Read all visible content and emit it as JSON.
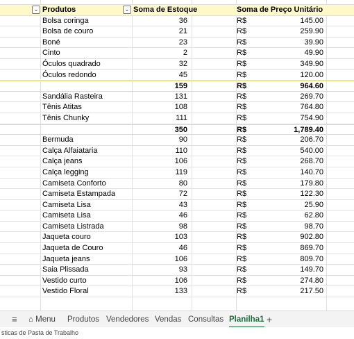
{
  "header": {
    "produtos": "Produtos",
    "estoque": "Soma de Estoque",
    "preco": "Soma de Preço Unitário"
  },
  "rows": [
    {
      "produto": "Bolsa coringa",
      "estoque": "36",
      "moeda": "R$",
      "preco": "145.00"
    },
    {
      "produto": "Bolsa de couro",
      "estoque": "21",
      "moeda": "R$",
      "preco": "259.90"
    },
    {
      "produto": "Boné",
      "estoque": "23",
      "moeda": "R$",
      "preco": "39.90"
    },
    {
      "produto": "Cinto",
      "estoque": "2",
      "moeda": "R$",
      "preco": "49.90"
    },
    {
      "produto": "Óculos quadrado",
      "estoque": "32",
      "moeda": "R$",
      "preco": "349.90"
    },
    {
      "produto": "Óculos redondo",
      "estoque": "45",
      "moeda": "R$",
      "preco": "120.00"
    },
    {
      "produto": "",
      "estoque": "159",
      "moeda": "R$",
      "preco": "964.60",
      "total": true
    },
    {
      "produto": "Sandália Rasteira",
      "estoque": "131",
      "moeda": "R$",
      "preco": "269.70"
    },
    {
      "produto": "Tênis Atitas",
      "estoque": "108",
      "moeda": "R$",
      "preco": "764.80"
    },
    {
      "produto": "Tênis Chunky",
      "estoque": "111",
      "moeda": "R$",
      "preco": "754.90"
    },
    {
      "produto": "",
      "estoque": "350",
      "moeda": "R$",
      "preco": "1,789.40",
      "total": true
    },
    {
      "produto": "Bermuda",
      "estoque": "90",
      "moeda": "R$",
      "preco": "206.70"
    },
    {
      "produto": "Calça Alfaiataria",
      "estoque": "110",
      "moeda": "R$",
      "preco": "540.00"
    },
    {
      "produto": "Calça jeans",
      "estoque": "106",
      "moeda": "R$",
      "preco": "268.70"
    },
    {
      "produto": "Calça legging",
      "estoque": "119",
      "moeda": "R$",
      "preco": "140.70"
    },
    {
      "produto": "Camiseta Conforto",
      "estoque": "80",
      "moeda": "R$",
      "preco": "179.80"
    },
    {
      "produto": "Camiseta Estampada",
      "estoque": "72",
      "moeda": "R$",
      "preco": "122.30"
    },
    {
      "produto": "Camiseta Lisa",
      "estoque": "43",
      "moeda": "R$",
      "preco": "25.90"
    },
    {
      "produto": "Camiseta Lisa",
      "estoque": "46",
      "moeda": "R$",
      "preco": "62.80"
    },
    {
      "produto": "Camiseta Listrada",
      "estoque": "98",
      "moeda": "R$",
      "preco": "98.70"
    },
    {
      "produto": "Jaqueta couro",
      "estoque": "103",
      "moeda": "R$",
      "preco": "902.80"
    },
    {
      "produto": "Jaqueta de Couro",
      "estoque": "46",
      "moeda": "R$",
      "preco": "869.70"
    },
    {
      "produto": "Jaqueta jeans",
      "estoque": "106",
      "moeda": "R$",
      "preco": "809.70"
    },
    {
      "produto": "Saia Plissada",
      "estoque": "93",
      "moeda": "R$",
      "preco": "149.70"
    },
    {
      "produto": "Vestido curto",
      "estoque": "106",
      "moeda": "R$",
      "preco": "274.80"
    },
    {
      "produto": "Vestido Floral",
      "estoque": "133",
      "moeda": "R$",
      "preco": "217.50"
    }
  ],
  "tabs": {
    "menu_label": "Menu",
    "items": [
      "Produtos",
      "Vendedores",
      "Vendas",
      "Consultas",
      "Planilha1"
    ],
    "active": "Planilha1",
    "add_label": "+"
  },
  "status": {
    "text": "sticas de Pasta de Trabalho"
  },
  "colors": {
    "header_bg": "#fff8c8",
    "active_tab": "#1a6e37"
  }
}
